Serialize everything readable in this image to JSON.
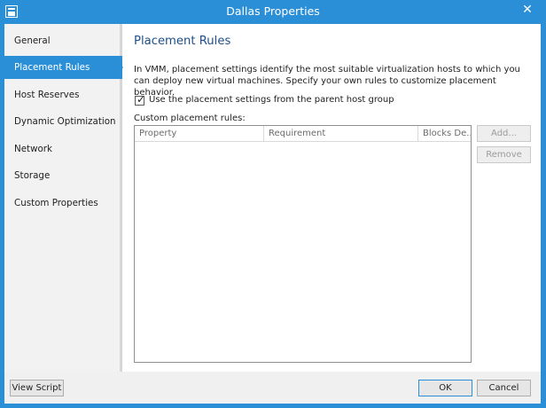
{
  "window": {
    "title": "Dallas Properties",
    "close_symbol": "✕"
  },
  "sidebar": {
    "items": [
      {
        "label": "General"
      },
      {
        "label": "Placement Rules",
        "selected": true
      },
      {
        "label": "Host Reserves"
      },
      {
        "label": "Dynamic Optimization"
      },
      {
        "label": "Network"
      },
      {
        "label": "Storage"
      },
      {
        "label": "Custom Properties"
      }
    ]
  },
  "main": {
    "title": "Placement Rules",
    "description": "In VMM, placement settings identify the most suitable virtualization hosts to which you can deploy new virtual machines. Specify your own rules to customize placement behavior.",
    "checkbox": {
      "label": "Use the placement settings from the parent host group",
      "checked": true
    },
    "rules_label": "Custom placement rules:",
    "columns": [
      "Property",
      "Requirement",
      "Blocks De..."
    ],
    "buttons": {
      "add": "Add...",
      "remove": "Remove"
    }
  },
  "footer": {
    "view_script": "View Script",
    "ok": "OK",
    "cancel": "Cancel"
  },
  "colors": {
    "accent": "#2b8fd8",
    "title_text": "#1d4f88"
  }
}
